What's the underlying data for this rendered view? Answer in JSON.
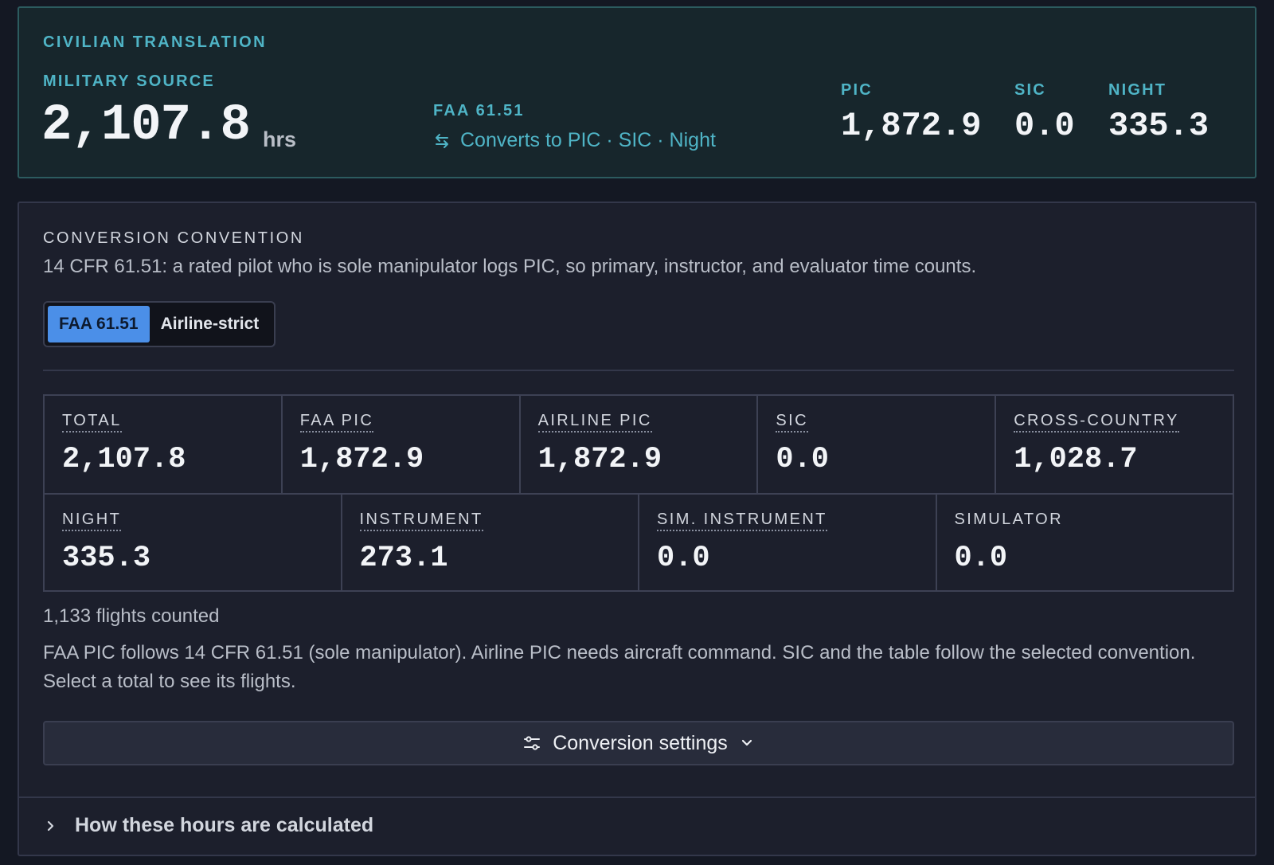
{
  "translation": {
    "heading": "CIVILIAN TRANSLATION",
    "source_label": "MILITARY SOURCE",
    "source_value": "2,107.8",
    "source_unit": "hrs",
    "rule_label": "FAA 61.51",
    "converts_text": "Converts to PIC · SIC · Night",
    "stats": [
      {
        "label": "PIC",
        "value": "1,872.9"
      },
      {
        "label": "SIC",
        "value": "0.0"
      },
      {
        "label": "NIGHT",
        "value": "335.3"
      }
    ]
  },
  "convention": {
    "heading": "CONVERSION CONVENTION",
    "description": "14 CFR 61.51: a rated pilot who is sole manipulator logs PIC, so primary, instructor, and evaluator time counts.",
    "options": [
      {
        "label": "FAA 61.51",
        "selected": true
      },
      {
        "label": "Airline-strict",
        "selected": false
      }
    ]
  },
  "totals": {
    "row1": [
      {
        "label": "TOTAL",
        "value": "2,107.8"
      },
      {
        "label": "FAA PIC",
        "value": "1,872.9"
      },
      {
        "label": "AIRLINE PIC",
        "value": "1,872.9"
      },
      {
        "label": "SIC",
        "value": "0.0"
      },
      {
        "label": "CROSS-COUNTRY",
        "value": "1,028.7"
      }
    ],
    "row2": [
      {
        "label": "NIGHT",
        "value": "335.3"
      },
      {
        "label": "INSTRUMENT",
        "value": "273.1"
      },
      {
        "label": "SIM. INSTRUMENT",
        "value": "0.0"
      },
      {
        "label": "SIMULATOR",
        "value": "0.0"
      }
    ]
  },
  "flights_counted": "1,133 flights counted",
  "note": "FAA PIC follows 14 CFR 61.51 (sole manipulator). Airline PIC needs aircraft command. SIC and the table follow the selected convention. Select a total to see its flights.",
  "settings_label": "Conversion settings",
  "how_label": "How these hours are calculated",
  "colors": {
    "accent_teal": "#4fb4c6",
    "selected_blue": "#4b8fe8",
    "background": "#141823"
  }
}
